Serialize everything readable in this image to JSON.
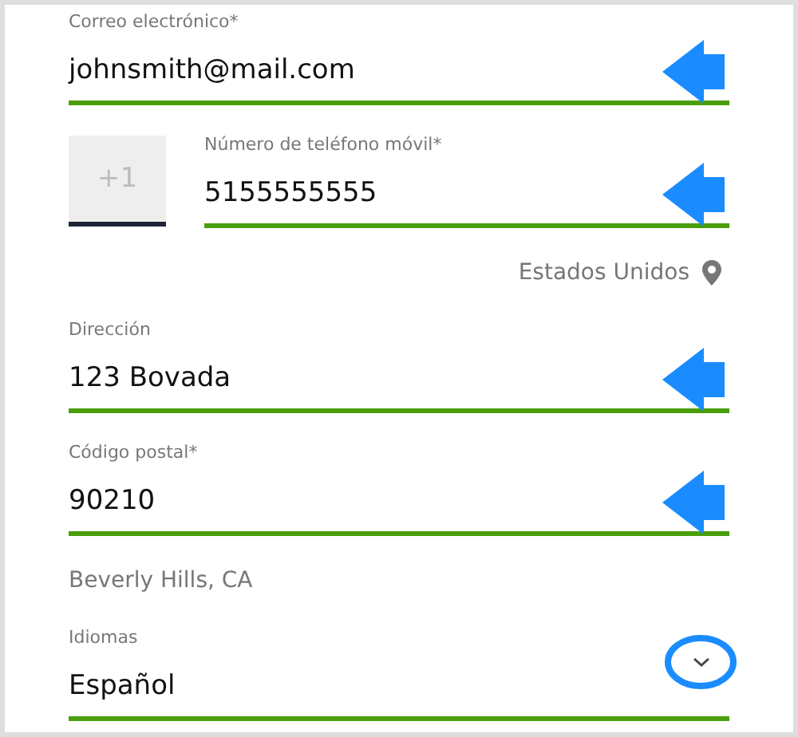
{
  "fields": [
    {
      "kind": "text",
      "label": "Correo electrónico*",
      "value": "johnsmith@mail.com",
      "highlighted": true
    },
    {
      "kind": "phone",
      "prefix": "+1",
      "label": "Número de teléfono móvil*",
      "value": "5155555555",
      "highlighted": true
    },
    {
      "kind": "country",
      "text": "Estados Unidos"
    },
    {
      "kind": "text",
      "label": "Dirección",
      "value": "123 Bovada",
      "highlighted": true
    },
    {
      "kind": "text",
      "label": "Código postal*",
      "value": "90210",
      "highlighted": true
    },
    {
      "kind": "city",
      "text": "Beverly Hills, CA"
    },
    {
      "kind": "select",
      "label": "Idiomas",
      "value": "Español",
      "highlighted": true
    }
  ]
}
